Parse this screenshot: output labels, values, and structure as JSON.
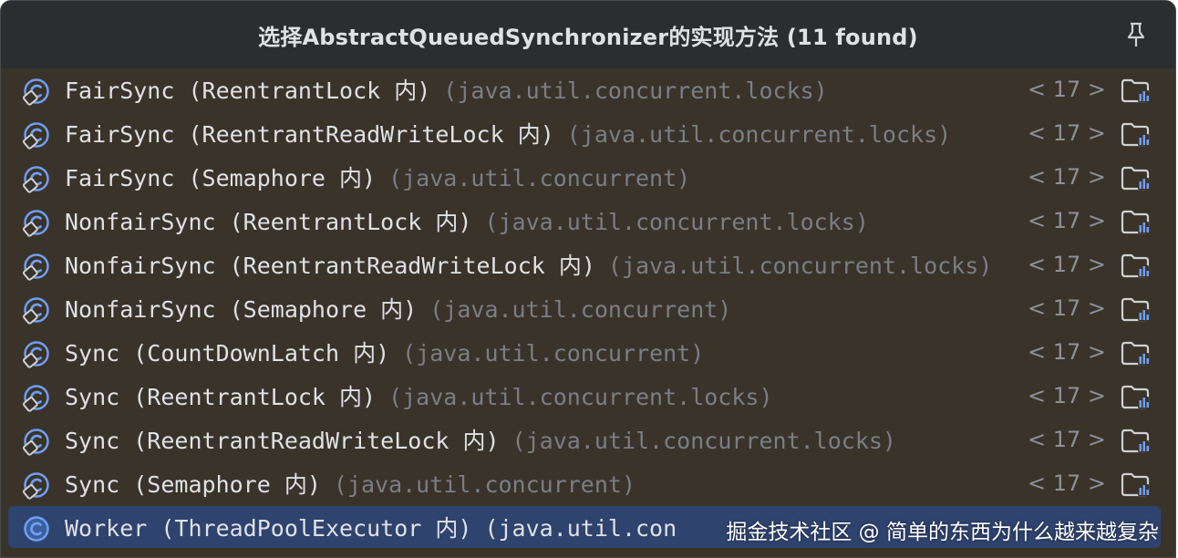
{
  "header": {
    "title": "选择AbstractQueuedSynchronizer的实现方法 (11 found)",
    "pin_icon": "pin-icon"
  },
  "rows": [
    {
      "name": "FairSync (ReentrantLock 内)",
      "package": "(java.util.concurrent.locks)",
      "count": "< 17 >",
      "selected": false
    },
    {
      "name": "FairSync (ReentrantReadWriteLock 内)",
      "package": "(java.util.concurrent.locks)",
      "count": "< 17 >",
      "selected": false
    },
    {
      "name": "FairSync (Semaphore 内)",
      "package": "(java.util.concurrent)",
      "count": "< 17 >",
      "selected": false
    },
    {
      "name": "NonfairSync (ReentrantLock 内)",
      "package": "(java.util.concurrent.locks)",
      "count": "< 17 >",
      "selected": false
    },
    {
      "name": "NonfairSync (ReentrantReadWriteLock 内)",
      "package": "(java.util.concurrent.locks)",
      "count": "< 17 >",
      "selected": false
    },
    {
      "name": "NonfairSync (Semaphore 内)",
      "package": "(java.util.concurrent)",
      "count": "< 17 >",
      "selected": false
    },
    {
      "name": "Sync (CountDownLatch 内)",
      "package": "(java.util.concurrent)",
      "count": "< 17 >",
      "selected": false
    },
    {
      "name": "Sync (ReentrantLock 内)",
      "package": "(java.util.concurrent.locks)",
      "count": "< 17 >",
      "selected": false
    },
    {
      "name": "Sync (ReentrantReadWriteLock 内)",
      "package": "(java.util.concurrent.locks)",
      "count": "< 17 >",
      "selected": false
    },
    {
      "name": "Sync (Semaphore 内)",
      "package": "(java.util.concurrent)",
      "count": "< 17 >",
      "selected": false
    },
    {
      "name": "Worker (ThreadPoolExecutor 内)",
      "package": "(java.util.con",
      "count": "",
      "selected": true
    }
  ],
  "watermark": "掘金技术社区 @ 简单的东西为什么越来越复杂",
  "colors": {
    "header_bg": "#2b2d30",
    "list_bg": "#3a332a",
    "selected_bg": "#2e436e",
    "text": "#dfe1e5",
    "muted": "#7a7e85"
  }
}
